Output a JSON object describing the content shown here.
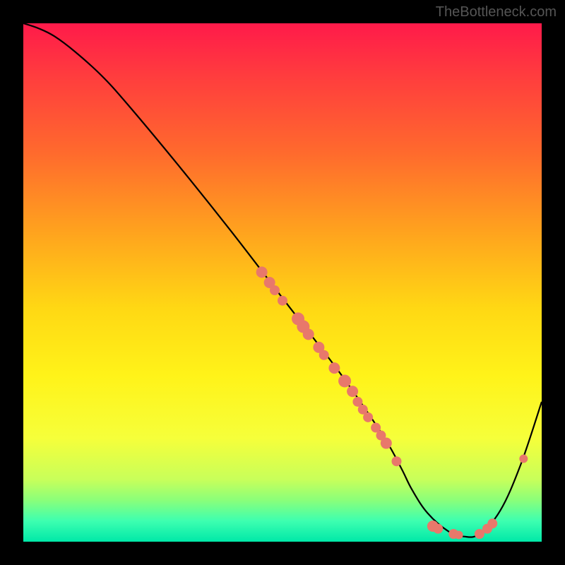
{
  "watermark": "TheBottleneck.com",
  "chart_data": {
    "type": "line",
    "title": "",
    "xlabel": "",
    "ylabel": "",
    "xlim": [
      0,
      100
    ],
    "ylim": [
      0,
      100
    ],
    "gradient_stops": [
      {
        "offset": 0.0,
        "color": "#ff1a4a"
      },
      {
        "offset": 0.1,
        "color": "#ff3c3e"
      },
      {
        "offset": 0.25,
        "color": "#ff6a2d"
      },
      {
        "offset": 0.4,
        "color": "#ffa21e"
      },
      {
        "offset": 0.55,
        "color": "#ffd814"
      },
      {
        "offset": 0.68,
        "color": "#fff319"
      },
      {
        "offset": 0.8,
        "color": "#f6ff3a"
      },
      {
        "offset": 0.88,
        "color": "#c8ff5a"
      },
      {
        "offset": 0.92,
        "color": "#8aff7a"
      },
      {
        "offset": 0.96,
        "color": "#3dffb0"
      },
      {
        "offset": 1.0,
        "color": "#00e8a8"
      }
    ],
    "series": [
      {
        "name": "bottleneck-curve",
        "x": [
          0,
          3,
          6,
          10,
          15,
          20,
          30,
          40,
          50,
          60,
          65,
          70,
          73,
          75,
          78,
          82,
          85,
          88,
          92,
          96,
          100
        ],
        "y": [
          100,
          99,
          97.5,
          94.5,
          90,
          84.5,
          72.5,
          60,
          47,
          34,
          27,
          19.5,
          14,
          10,
          5.5,
          2,
          1,
          1.5,
          6,
          15,
          27
        ]
      }
    ],
    "scatter_points": {
      "name": "markers",
      "points": [
        {
          "x": 46,
          "y": 52,
          "r": 8
        },
        {
          "x": 47.5,
          "y": 50,
          "r": 8
        },
        {
          "x": 48.5,
          "y": 48.5,
          "r": 7
        },
        {
          "x": 50,
          "y": 46.5,
          "r": 7
        },
        {
          "x": 53,
          "y": 43,
          "r": 9
        },
        {
          "x": 54,
          "y": 41.5,
          "r": 9
        },
        {
          "x": 55,
          "y": 40,
          "r": 8
        },
        {
          "x": 57,
          "y": 37.5,
          "r": 8
        },
        {
          "x": 58,
          "y": 36,
          "r": 7
        },
        {
          "x": 60,
          "y": 33.5,
          "r": 8
        },
        {
          "x": 62,
          "y": 31,
          "r": 9
        },
        {
          "x": 63.5,
          "y": 29,
          "r": 8
        },
        {
          "x": 64.5,
          "y": 27,
          "r": 7
        },
        {
          "x": 65.5,
          "y": 25.5,
          "r": 7
        },
        {
          "x": 66.5,
          "y": 24,
          "r": 7
        },
        {
          "x": 68,
          "y": 22,
          "r": 7
        },
        {
          "x": 69,
          "y": 20.5,
          "r": 7
        },
        {
          "x": 70,
          "y": 19,
          "r": 8
        },
        {
          "x": 72,
          "y": 15.5,
          "r": 7
        },
        {
          "x": 79,
          "y": 3,
          "r": 8
        },
        {
          "x": 80,
          "y": 2.5,
          "r": 7
        },
        {
          "x": 83,
          "y": 1.5,
          "r": 7
        },
        {
          "x": 84,
          "y": 1.3,
          "r": 6
        },
        {
          "x": 88,
          "y": 1.5,
          "r": 7
        },
        {
          "x": 89.5,
          "y": 2.5,
          "r": 7
        },
        {
          "x": 90.5,
          "y": 3.5,
          "r": 7
        },
        {
          "x": 96.5,
          "y": 16,
          "r": 6
        }
      ]
    }
  }
}
